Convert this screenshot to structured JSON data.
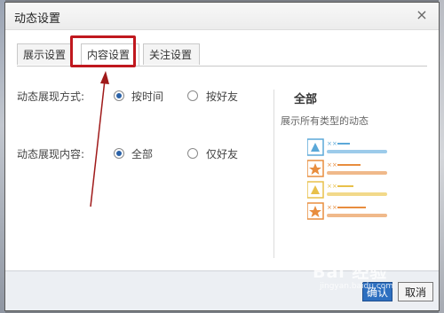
{
  "dialog": {
    "title": "动态设置",
    "close_glyph": "×"
  },
  "tabs": [
    {
      "label": "展示设置"
    },
    {
      "label": "内容设置"
    },
    {
      "label": "关注设置"
    }
  ],
  "form": {
    "row1": {
      "label": "动态展现方式:",
      "options": [
        {
          "label": "按时间",
          "selected": true
        },
        {
          "label": "按好友",
          "selected": false
        }
      ]
    },
    "row2": {
      "label": "动态展现内容:",
      "options": [
        {
          "label": "全部",
          "selected": true
        },
        {
          "label": "仅好友",
          "selected": false
        }
      ]
    }
  },
  "preview": {
    "title": "全部",
    "description": "展示所有类型的动态",
    "item_marker": "××"
  },
  "buttons": {
    "ok": "确认",
    "cancel": "取消"
  },
  "watermark": {
    "main": "Bai 经验",
    "sub": "jingyan.baidu.com"
  },
  "colors": {
    "radio_on": "#2a62a8",
    "highlight": "#c0181e",
    "feed_blue": "#5ba8d8",
    "feed_orange": "#e88d3e",
    "feed_yellow": "#e8c04a"
  }
}
